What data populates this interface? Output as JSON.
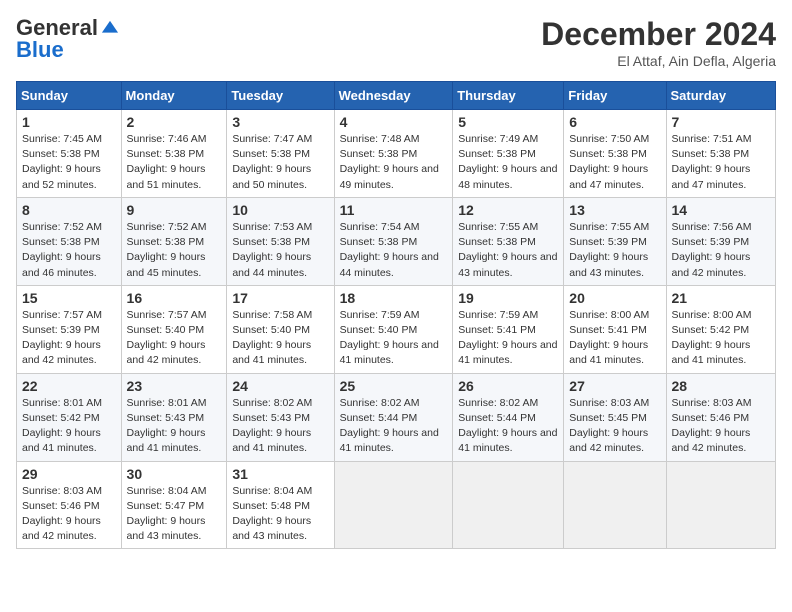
{
  "header": {
    "logo_line1": "General",
    "logo_line2": "Blue",
    "month_title": "December 2024",
    "location": "El Attaf, Ain Defla, Algeria"
  },
  "weekdays": [
    "Sunday",
    "Monday",
    "Tuesday",
    "Wednesday",
    "Thursday",
    "Friday",
    "Saturday"
  ],
  "weeks": [
    [
      {
        "day": "1",
        "sunrise": "7:45 AM",
        "sunset": "5:38 PM",
        "daylight": "9 hours and 52 minutes."
      },
      {
        "day": "2",
        "sunrise": "7:46 AM",
        "sunset": "5:38 PM",
        "daylight": "9 hours and 51 minutes."
      },
      {
        "day": "3",
        "sunrise": "7:47 AM",
        "sunset": "5:38 PM",
        "daylight": "9 hours and 50 minutes."
      },
      {
        "day": "4",
        "sunrise": "7:48 AM",
        "sunset": "5:38 PM",
        "daylight": "9 hours and 49 minutes."
      },
      {
        "day": "5",
        "sunrise": "7:49 AM",
        "sunset": "5:38 PM",
        "daylight": "9 hours and 48 minutes."
      },
      {
        "day": "6",
        "sunrise": "7:50 AM",
        "sunset": "5:38 PM",
        "daylight": "9 hours and 47 minutes."
      },
      {
        "day": "7",
        "sunrise": "7:51 AM",
        "sunset": "5:38 PM",
        "daylight": "9 hours and 47 minutes."
      }
    ],
    [
      {
        "day": "8",
        "sunrise": "7:52 AM",
        "sunset": "5:38 PM",
        "daylight": "9 hours and 46 minutes."
      },
      {
        "day": "9",
        "sunrise": "7:52 AM",
        "sunset": "5:38 PM",
        "daylight": "9 hours and 45 minutes."
      },
      {
        "day": "10",
        "sunrise": "7:53 AM",
        "sunset": "5:38 PM",
        "daylight": "9 hours and 44 minutes."
      },
      {
        "day": "11",
        "sunrise": "7:54 AM",
        "sunset": "5:38 PM",
        "daylight": "9 hours and 44 minutes."
      },
      {
        "day": "12",
        "sunrise": "7:55 AM",
        "sunset": "5:38 PM",
        "daylight": "9 hours and 43 minutes."
      },
      {
        "day": "13",
        "sunrise": "7:55 AM",
        "sunset": "5:39 PM",
        "daylight": "9 hours and 43 minutes."
      },
      {
        "day": "14",
        "sunrise": "7:56 AM",
        "sunset": "5:39 PM",
        "daylight": "9 hours and 42 minutes."
      }
    ],
    [
      {
        "day": "15",
        "sunrise": "7:57 AM",
        "sunset": "5:39 PM",
        "daylight": "9 hours and 42 minutes."
      },
      {
        "day": "16",
        "sunrise": "7:57 AM",
        "sunset": "5:40 PM",
        "daylight": "9 hours and 42 minutes."
      },
      {
        "day": "17",
        "sunrise": "7:58 AM",
        "sunset": "5:40 PM",
        "daylight": "9 hours and 41 minutes."
      },
      {
        "day": "18",
        "sunrise": "7:59 AM",
        "sunset": "5:40 PM",
        "daylight": "9 hours and 41 minutes."
      },
      {
        "day": "19",
        "sunrise": "7:59 AM",
        "sunset": "5:41 PM",
        "daylight": "9 hours and 41 minutes."
      },
      {
        "day": "20",
        "sunrise": "8:00 AM",
        "sunset": "5:41 PM",
        "daylight": "9 hours and 41 minutes."
      },
      {
        "day": "21",
        "sunrise": "8:00 AM",
        "sunset": "5:42 PM",
        "daylight": "9 hours and 41 minutes."
      }
    ],
    [
      {
        "day": "22",
        "sunrise": "8:01 AM",
        "sunset": "5:42 PM",
        "daylight": "9 hours and 41 minutes."
      },
      {
        "day": "23",
        "sunrise": "8:01 AM",
        "sunset": "5:43 PM",
        "daylight": "9 hours and 41 minutes."
      },
      {
        "day": "24",
        "sunrise": "8:02 AM",
        "sunset": "5:43 PM",
        "daylight": "9 hours and 41 minutes."
      },
      {
        "day": "25",
        "sunrise": "8:02 AM",
        "sunset": "5:44 PM",
        "daylight": "9 hours and 41 minutes."
      },
      {
        "day": "26",
        "sunrise": "8:02 AM",
        "sunset": "5:44 PM",
        "daylight": "9 hours and 41 minutes."
      },
      {
        "day": "27",
        "sunrise": "8:03 AM",
        "sunset": "5:45 PM",
        "daylight": "9 hours and 42 minutes."
      },
      {
        "day": "28",
        "sunrise": "8:03 AM",
        "sunset": "5:46 PM",
        "daylight": "9 hours and 42 minutes."
      }
    ],
    [
      {
        "day": "29",
        "sunrise": "8:03 AM",
        "sunset": "5:46 PM",
        "daylight": "9 hours and 42 minutes."
      },
      {
        "day": "30",
        "sunrise": "8:04 AM",
        "sunset": "5:47 PM",
        "daylight": "9 hours and 43 minutes."
      },
      {
        "day": "31",
        "sunrise": "8:04 AM",
        "sunset": "5:48 PM",
        "daylight": "9 hours and 43 minutes."
      },
      null,
      null,
      null,
      null
    ]
  ],
  "labels": {
    "sunrise": "Sunrise:",
    "sunset": "Sunset:",
    "daylight": "Daylight:"
  }
}
